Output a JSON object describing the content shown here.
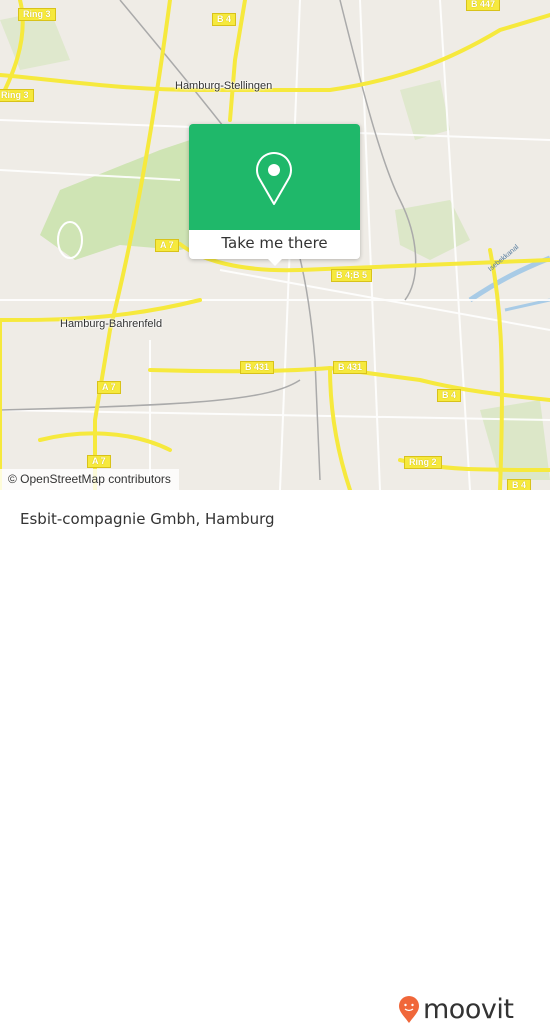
{
  "map": {
    "place_labels": [
      "Hamburg-Stellingen",
      "Hamburg-Bahrenfeld"
    ],
    "road_shields": [
      "Ring 3",
      "B 4",
      "B 447",
      "Ring 3",
      "A 7",
      "B 4;B 5",
      "B 431",
      "B 431",
      "A 7",
      "B 4",
      "A 7",
      "Ring 2",
      "B 4"
    ],
    "water_labels": [
      "Isebekkanal"
    ],
    "attribution": "© OpenStreetMap contributors",
    "colors": {
      "background": "#efece6",
      "major_road": "#f6e93d",
      "park": "#cfe4b4",
      "water": "#a8cbe6"
    }
  },
  "popup": {
    "icon": "map-pin-icon",
    "button_label": "Take me there",
    "color": "#1fb86a"
  },
  "footer": {
    "title": "Esbit-compagnie Gmbh, Hamburg",
    "logo_text": "moovit",
    "logo_color": "#f0673a"
  }
}
